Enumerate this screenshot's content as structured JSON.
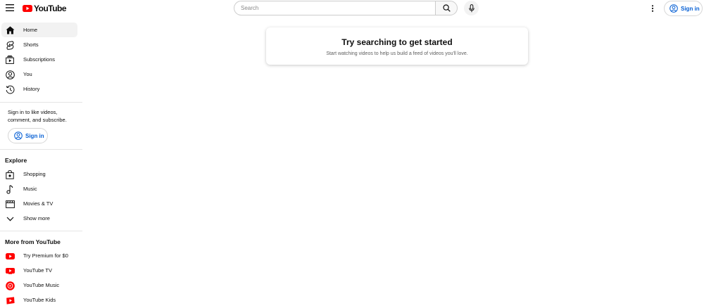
{
  "header": {
    "logo_text": "YouTube",
    "search_placeholder": "Search",
    "signin_label": "Sign in"
  },
  "sidebar": {
    "main_items": [
      {
        "label": "Home",
        "icon": "home-icon",
        "active": true
      },
      {
        "label": "Shorts",
        "icon": "shorts-icon"
      },
      {
        "label": "Subscriptions",
        "icon": "subscriptions-icon"
      },
      {
        "label": "You",
        "icon": "you-icon"
      },
      {
        "label": "History",
        "icon": "history-icon"
      }
    ],
    "signin_prompt": "Sign in to like videos, comment, and subscribe.",
    "signin_label": "Sign in",
    "explore_title": "Explore",
    "explore_items": [
      {
        "label": "Shopping",
        "icon": "shopping-bag-icon"
      },
      {
        "label": "Music",
        "icon": "music-note-icon"
      },
      {
        "label": "Movies & TV",
        "icon": "movies-icon"
      },
      {
        "label": "Show more",
        "icon": "chevron-down-icon"
      }
    ],
    "more_title": "More from YouTube",
    "more_items": [
      {
        "label": "Try Premium for $0",
        "icon": "youtube-premium-icon"
      },
      {
        "label": "YouTube TV",
        "icon": "youtube-tv-icon"
      },
      {
        "label": "YouTube Music",
        "icon": "youtube-music-icon"
      },
      {
        "label": "YouTube Kids",
        "icon": "youtube-kids-icon"
      }
    ]
  },
  "main": {
    "card_title": "Try searching to get started",
    "card_subtitle": "Start watching videos to help us build a feed of videos you'll love."
  },
  "colors": {
    "brand_red": "#ff0000",
    "link_blue": "#065fd4",
    "active_bg": "#f2f2f2"
  }
}
